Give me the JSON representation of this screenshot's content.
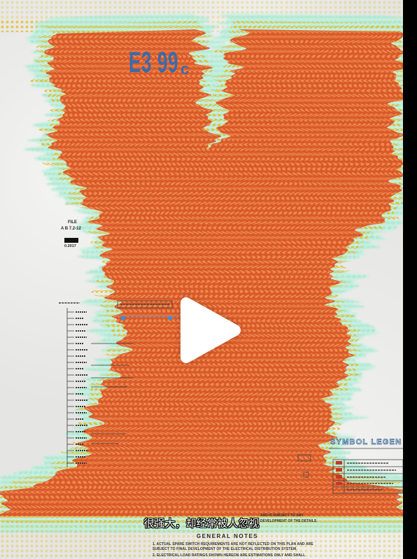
{
  "player": {
    "play_icon": "play-icon",
    "subtitle": "很强大，却经常被人忽视"
  },
  "artwork": {
    "stamp_code": "E3 99",
    "stamp_suffix": "c",
    "file_label": "FILE",
    "file_number": "A B 7.2-12",
    "file_date": "0.2017",
    "legend_title": "SYMBOL LEGEN",
    "plan_note_lines": [
      "AND IS SUBJECT TO ANY",
      "DEVELOPMENT OF THE DETAILS."
    ],
    "notes_title": "GENERAL NOTES",
    "notes": [
      "1. ACTUAL SPARE SWITCH REQUIREMENTS ARE NOT REFLECTED ON THIS PLAN AND ARE",
      "SUBJECT TO FINAL DEVELOPMENT OF THE ELECTRICAL DISTRIBUTION SYSTEM.",
      "2. ELECTRICAL LOAD RATINGS SHOWN HEREON ARE ESTIMATIONS ONLY AND SHALL"
    ]
  },
  "colors": {
    "halftone": "#d9592b",
    "fringe": "#a8ead1",
    "dots": "#e3bf35",
    "stamp": "#2d6bb5",
    "letterbox": "#000000"
  }
}
